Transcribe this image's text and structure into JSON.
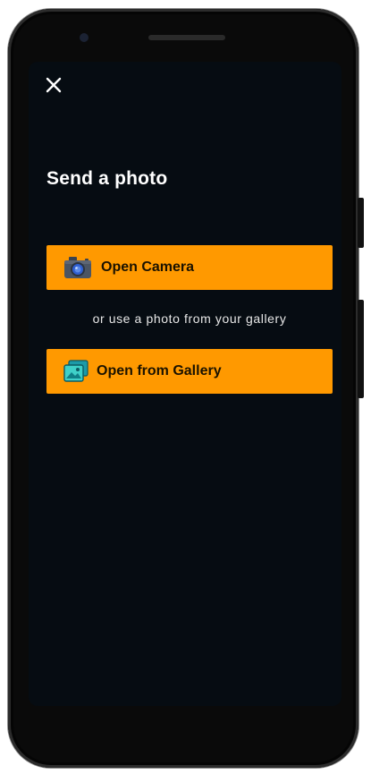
{
  "screen": {
    "title": "Send a photo",
    "close_icon": "close-icon",
    "camera_button": {
      "label": "Open Camera",
      "icon": "camera-icon"
    },
    "divider_text": "or use a photo from your gallery",
    "gallery_button": {
      "label": "Open from Gallery",
      "icon": "gallery-image-icon"
    }
  },
  "colors": {
    "background": "#060c12",
    "button": "#ff9900",
    "button_text": "#1a1200",
    "text": "#ffffff"
  }
}
